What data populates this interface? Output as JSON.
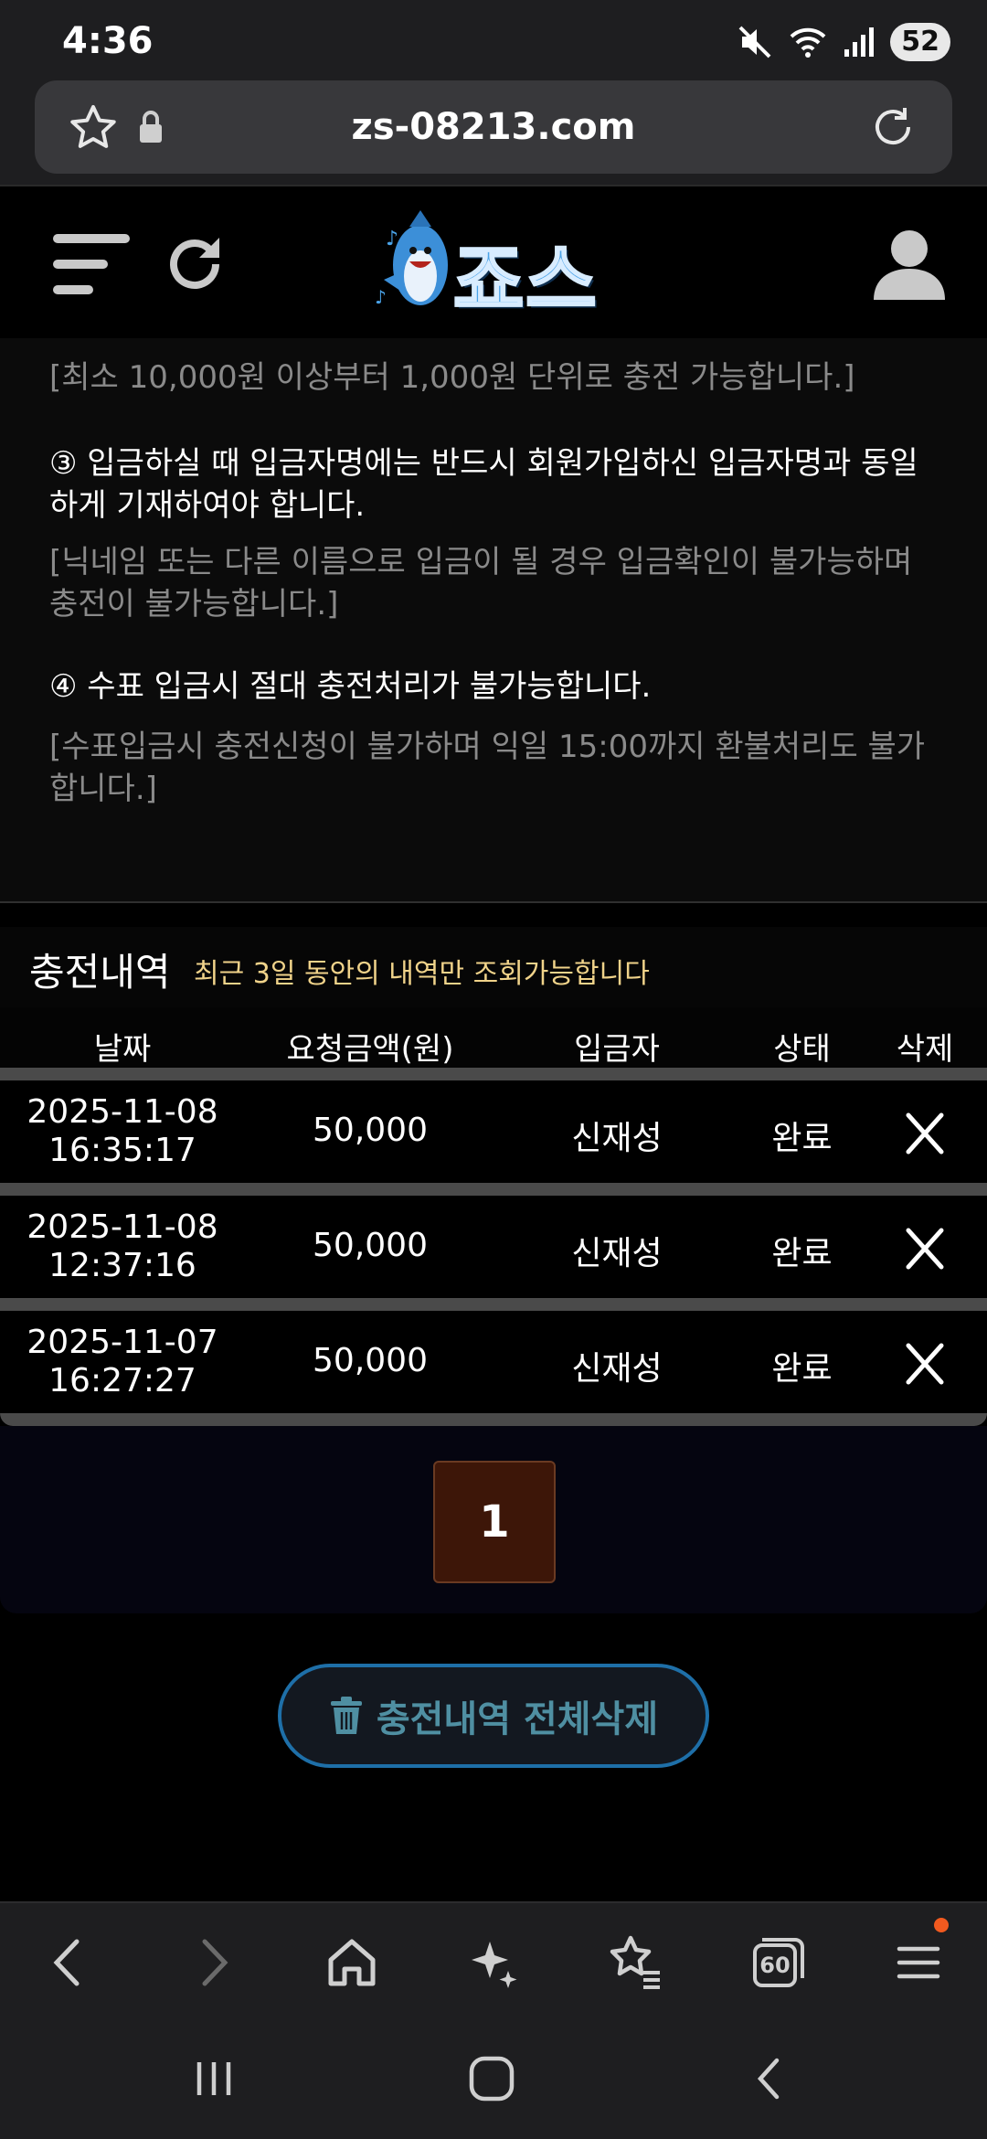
{
  "status_bar": {
    "time": "4:36",
    "battery": "52"
  },
  "browser": {
    "url": "zs-08213.com",
    "tab_count": "60"
  },
  "site": {
    "logo_text": "죠스"
  },
  "notice": {
    "line1_sub": "[최소 10,000원 이상부터 1,000원 단위로 충전 가능합니다.]",
    "item3_main": "③ 입금하실 때 입금자명에는 반드시 회원가입하신 입금자명과 동일하게 기재하여야 합니다.",
    "item3_sub": "[닉네임 또는 다른 이름으로 입금이 될 경우 입금확인이 불가능하며 충전이 불가능합니다.]",
    "item4_main": "④ 수표 입금시 절대 충전처리가 불가능합니다.",
    "item4_sub": "[수표입금시 충전신청이 불가하며 익일 15:00까지 환불처리도 불가합니다.]"
  },
  "history": {
    "title": "충전내역",
    "note": "최근 3일 동안의 내역만 조회가능합니다",
    "columns": {
      "date": "날짜",
      "amount": "요청금액(원)",
      "depositor": "입금자",
      "status": "상태",
      "delete": "삭제"
    },
    "rows": [
      {
        "date": "2025-11-08",
        "time": "16:35:17",
        "amount": "50,000",
        "depositor": "신재성",
        "status": "완료"
      },
      {
        "date": "2025-11-08",
        "time": "12:37:16",
        "amount": "50,000",
        "depositor": "신재성",
        "status": "완료"
      },
      {
        "date": "2025-11-07",
        "time": "16:27:27",
        "amount": "50,000",
        "depositor": "신재성",
        "status": "완료"
      }
    ]
  },
  "pagination": {
    "current_page": "1"
  },
  "actions": {
    "delete_all_label": "충전내역 전체삭제"
  },
  "icons": {
    "star": "star-icon",
    "lock": "lock-icon",
    "reload": "reload-icon",
    "menu": "hamburger-icon",
    "user": "user-icon",
    "close": "close-icon",
    "trash": "trash-icon"
  },
  "colors": {
    "accent_gold": "#f0d38a",
    "page_active": "#3d1608",
    "delete_border": "#1e6fa8"
  }
}
